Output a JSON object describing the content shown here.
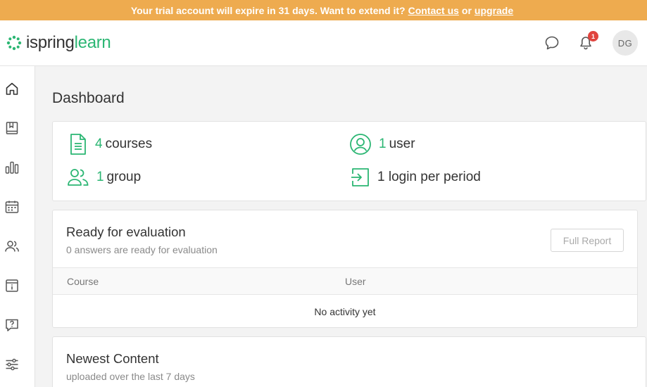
{
  "banner": {
    "text": "Your trial account will expire in 31 days. Want to extend it?",
    "contact_link": "Contact us",
    "or_text": "or",
    "upgrade_link": "upgrade",
    "color": "#eeab4f"
  },
  "header": {
    "logo_part1": "ispring",
    "logo_part2": "learn",
    "notification_count": "1",
    "avatar_initials": "DG",
    "icons": [
      "chat-icon",
      "bell-icon"
    ]
  },
  "sidebar": {
    "items": [
      {
        "icon": "home-icon"
      },
      {
        "icon": "book-icon"
      },
      {
        "icon": "reports-icon"
      },
      {
        "icon": "calendar-icon"
      },
      {
        "icon": "users-icon"
      },
      {
        "icon": "info-icon"
      },
      {
        "icon": "help-icon"
      },
      {
        "icon": "settings-icon"
      }
    ]
  },
  "dashboard": {
    "title": "Dashboard",
    "stats": {
      "courses": {
        "num": "4",
        "label": "courses",
        "icon": "document-icon"
      },
      "users": {
        "num": "1",
        "label": "user",
        "icon": "user-icon"
      },
      "groups": {
        "num": "1",
        "label": "group",
        "icon": "group-icon"
      },
      "logins": {
        "label": "1 login per period",
        "icon": "login-icon"
      }
    },
    "evaluation": {
      "title": "Ready for evaluation",
      "subtitle": "0 answers are ready for evaluation",
      "button": "Full Report",
      "columns": [
        "Course",
        "User"
      ],
      "empty": "No activity yet"
    },
    "newest": {
      "title": "Newest Content",
      "subtitle": "uploaded over the last 7 days"
    }
  },
  "colors": {
    "accent": "#2bb673",
    "badge": "#e0443e",
    "background": "#f3f3f3"
  }
}
